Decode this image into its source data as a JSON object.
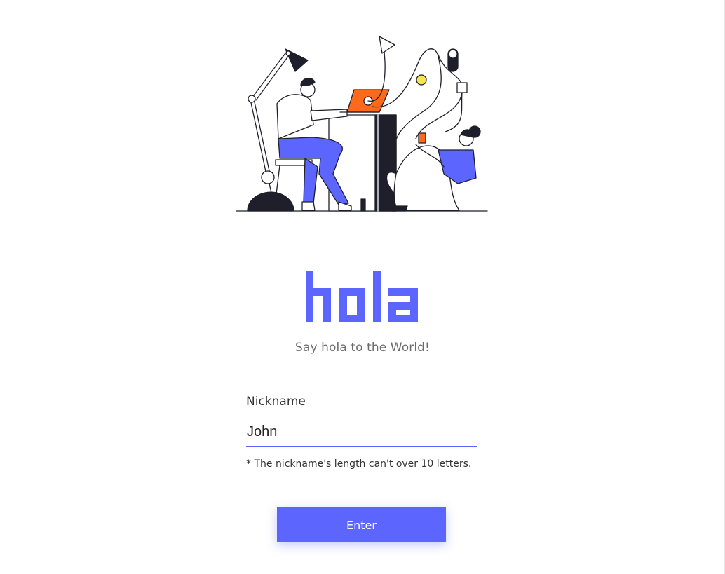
{
  "colors": {
    "accent": "#5c66ff",
    "laptop_orange": "#ff6a1a",
    "bulb_yellow": "#f5e64a",
    "ink": "#1f1f2b"
  },
  "illustration": {
    "icon": "people-working-illustration"
  },
  "logo": {
    "text": "hola"
  },
  "tagline": "Say hola to the World!",
  "form": {
    "nickname_label": "Nickname",
    "nickname_value": "John",
    "nickname_hint": "* The nickname's length can't over 10 letters.",
    "enter_label": "Enter"
  }
}
